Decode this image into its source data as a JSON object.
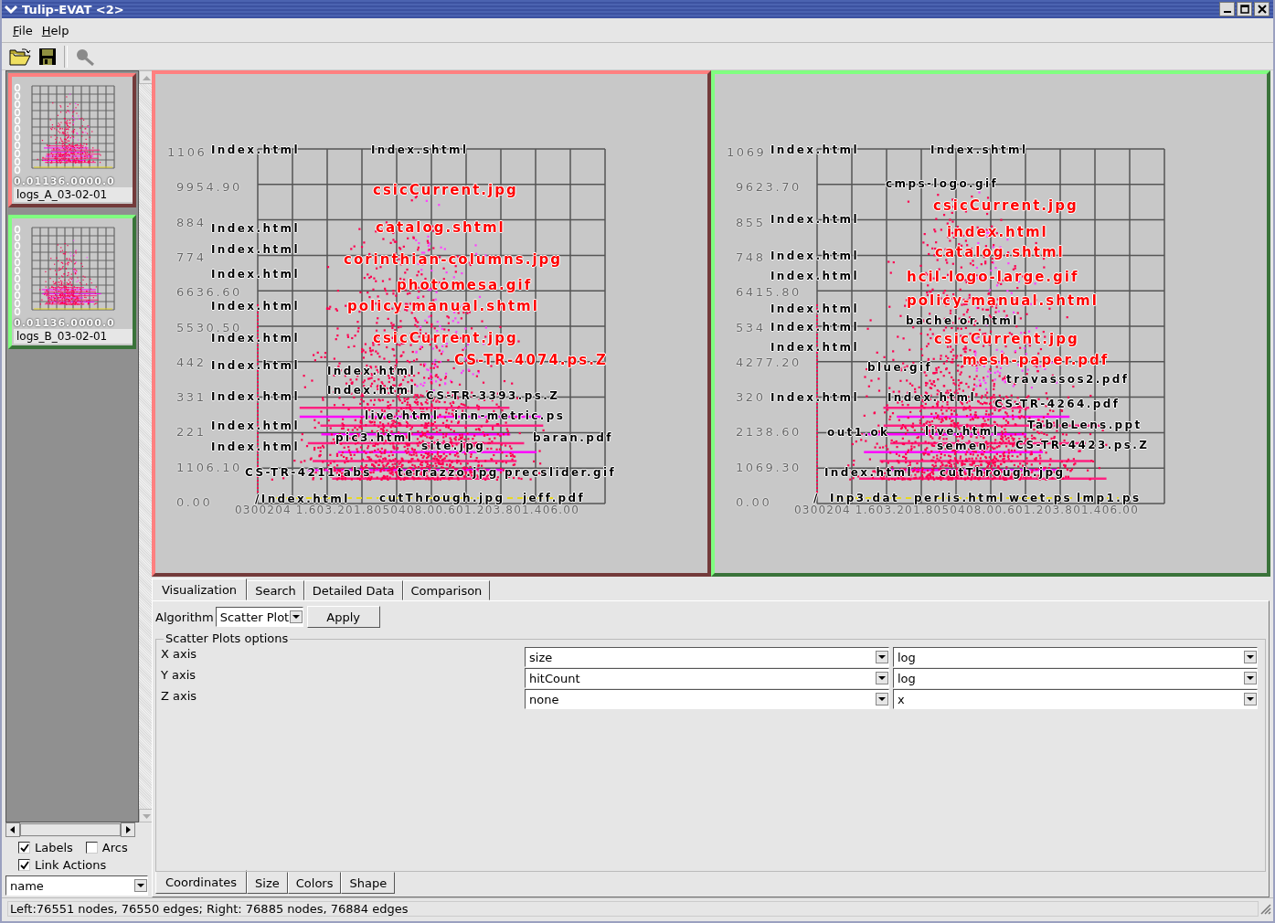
{
  "window": {
    "title": "Tulip-EVAT <2>"
  },
  "menu": [
    "File",
    "Help"
  ],
  "thumbnails": [
    {
      "caption": "logs_A_03-02-01",
      "axis_text": "0.01136.0000.0",
      "color": "#ff8080"
    },
    {
      "caption": "logs_B_03-02-01",
      "axis_text": "0.01136.0000.0",
      "color": "#80ff80"
    }
  ],
  "display_options": [
    {
      "label": "Labels",
      "checked": true
    },
    {
      "label": "Arcs",
      "checked": false
    },
    {
      "label": "Link Actions",
      "checked": true
    }
  ],
  "property_combo": {
    "value": "name"
  },
  "plots": [
    {
      "color": "#ff8080",
      "y_ticks": [
        "1106",
        "9954.90",
        "884",
        "774",
        "6636.60",
        "5530.50",
        "442",
        "331",
        "221",
        "1106.10",
        "0.00"
      ],
      "x_axis_text": "0300204 1.603.201.8050408.00.601.203.801.406.00",
      "labels": [
        {
          "text": "Index.html",
          "kind": "plain"
        },
        {
          "text": "Index.shtml",
          "kind": "plain"
        },
        {
          "text": "csicCurrent.jpg",
          "kind": "highlight"
        },
        {
          "text": "Index.html",
          "kind": "plain"
        },
        {
          "text": "catalog.shtml",
          "kind": "highlight"
        },
        {
          "text": "Index.html",
          "kind": "plain"
        },
        {
          "text": "corinthian-columns.jpg",
          "kind": "highlight"
        },
        {
          "text": "Index.html",
          "kind": "plain"
        },
        {
          "text": "photomesa.gif",
          "kind": "highlight"
        },
        {
          "text": "Index.html",
          "kind": "plain"
        },
        {
          "text": "policy-manual.shtml",
          "kind": "highlight"
        },
        {
          "text": "Index.html",
          "kind": "plain"
        },
        {
          "text": "csicCurrent.jpg",
          "kind": "highlight"
        },
        {
          "text": "Index.html",
          "kind": "plain"
        },
        {
          "text": "CS-TR-4074.ps.Z",
          "kind": "highlight"
        },
        {
          "text": "Index.html",
          "kind": "plain"
        },
        {
          "text": "Index.html",
          "kind": "plain"
        },
        {
          "text": "Index.html",
          "kind": "plain"
        },
        {
          "text": "CS-TR-3393.ps.Z",
          "kind": "plain"
        },
        {
          "text": "live.html",
          "kind": "plain"
        },
        {
          "text": "inn-metric.ps",
          "kind": "plain"
        },
        {
          "text": "Index.html",
          "kind": "plain"
        },
        {
          "text": "pic3.html",
          "kind": "plain"
        },
        {
          "text": "baran.pdf",
          "kind": "plain"
        },
        {
          "text": "Index.html",
          "kind": "plain"
        },
        {
          "text": "site.jpg",
          "kind": "plain"
        },
        {
          "text": "CS-TR-4211.abs",
          "kind": "plain"
        },
        {
          "text": "terrazzo.jpg",
          "kind": "plain"
        },
        {
          "text": "precslider.gif",
          "kind": "plain"
        },
        {
          "text": "/Index.html",
          "kind": "plain"
        },
        {
          "text": "cutThrough.jpg",
          "kind": "plain"
        },
        {
          "text": "jeff.pdf",
          "kind": "plain"
        }
      ]
    },
    {
      "color": "#80ff80",
      "y_ticks": [
        "1069",
        "9623.70",
        "855",
        "748",
        "6415.80",
        "534",
        "4277.20",
        "320",
        "2138.60",
        "1069.30",
        "0.00"
      ],
      "x_axis_text": "0300204 1.603.201.8050408.00.601.203.801.406.00",
      "labels": [
        {
          "text": "Index.html",
          "kind": "plain"
        },
        {
          "text": "Index.shtml",
          "kind": "plain"
        },
        {
          "text": "cmps-logo.gif",
          "kind": "plain"
        },
        {
          "text": "csicCurrent.jpg",
          "kind": "highlight"
        },
        {
          "text": "Index.html",
          "kind": "plain"
        },
        {
          "text": "index.html",
          "kind": "highlight"
        },
        {
          "text": "Index.html",
          "kind": "plain"
        },
        {
          "text": "catalog.shtml",
          "kind": "highlight"
        },
        {
          "text": "Index.html",
          "kind": "plain"
        },
        {
          "text": "hcil-logo-large.gif",
          "kind": "highlight"
        },
        {
          "text": "policy-manual.shtml",
          "kind": "highlight"
        },
        {
          "text": "Index.html",
          "kind": "plain"
        },
        {
          "text": "bachelor.html",
          "kind": "plain"
        },
        {
          "text": "Index.html",
          "kind": "plain"
        },
        {
          "text": "csicCurrent.jpg",
          "kind": "highlight"
        },
        {
          "text": "Index.html",
          "kind": "plain"
        },
        {
          "text": "mesh-paper.pdf",
          "kind": "highlight"
        },
        {
          "text": "blue.gif",
          "kind": "plain"
        },
        {
          "text": "travassos2.pdf",
          "kind": "plain"
        },
        {
          "text": "Index.html",
          "kind": "plain"
        },
        {
          "text": "Index.html",
          "kind": "plain"
        },
        {
          "text": "CS-TR-4264.pdf",
          "kind": "plain"
        },
        {
          "text": "TableLens.ppt",
          "kind": "plain"
        },
        {
          "text": "out1.ok",
          "kind": "plain"
        },
        {
          "text": "live.html",
          "kind": "plain"
        },
        {
          "text": "semen",
          "kind": "plain"
        },
        {
          "text": "CS-TR-4423.ps.Z",
          "kind": "plain"
        },
        {
          "text": "Index.html",
          "kind": "plain"
        },
        {
          "text": "cutThrough.jpg",
          "kind": "plain"
        },
        {
          "text": "/",
          "kind": "plain"
        },
        {
          "text": "Inp3.dat",
          "kind": "plain"
        },
        {
          "text": "perlis.html",
          "kind": "plain"
        },
        {
          "text": "wcet.ps",
          "kind": "plain"
        },
        {
          "text": "lmp1.ps",
          "kind": "plain"
        }
      ]
    }
  ],
  "tabs": [
    {
      "label": "Visualization",
      "selected": true
    },
    {
      "label": "Search",
      "selected": false
    },
    {
      "label": "Detailed Data",
      "selected": false
    },
    {
      "label": "Comparison",
      "selected": false
    }
  ],
  "algorithm": {
    "label": "Algorithm",
    "value": "Scatter Plot",
    "apply": "Apply"
  },
  "options": {
    "title": "Scatter Plots options",
    "rows": [
      {
        "label": "X axis",
        "field": "size",
        "scale": "log"
      },
      {
        "label": "Y axis",
        "field": "hitCount",
        "scale": "log"
      },
      {
        "label": "Z axis",
        "field": "none",
        "scale": "x"
      }
    ]
  },
  "bottom_tabs": [
    {
      "label": "Coordinates",
      "selected": true
    },
    {
      "label": "Size",
      "selected": false
    },
    {
      "label": "Colors",
      "selected": false
    },
    {
      "label": "Shape",
      "selected": false
    }
  ],
  "status_bar": "Left:76551 nodes, 76550 edges; Right: 76885 nodes, 76884 edges"
}
